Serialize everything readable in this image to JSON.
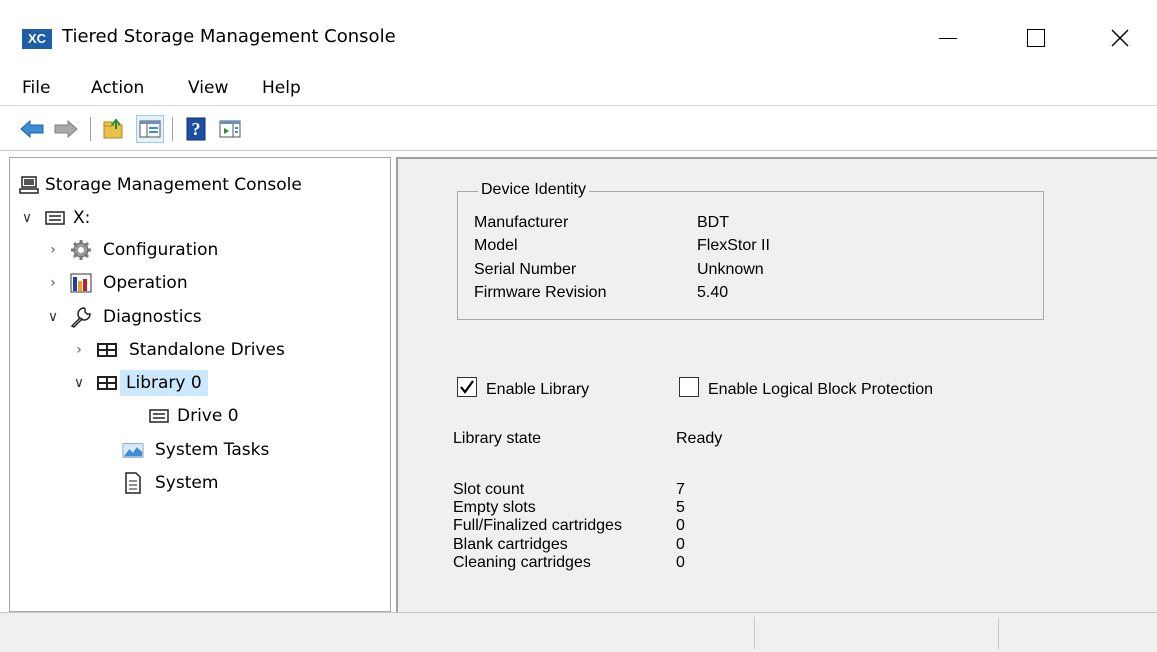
{
  "window": {
    "app_icon_text": "XC",
    "title": "Tiered Storage Management Console"
  },
  "menu": [
    "File",
    "Action",
    "View",
    "Help"
  ],
  "toolbar": [
    "back-arrow-icon",
    "forward-arrow-icon",
    "up-folder-icon",
    "show-hide-tree-icon",
    "help-icon",
    "action-pane-icon"
  ],
  "tree": {
    "root": "Storage Management Console",
    "drive_x": "X:",
    "configuration": "Configuration",
    "operation": "Operation",
    "diagnostics": "Diagnostics",
    "standalone_drives": "Standalone Drives",
    "library0": "Library 0",
    "drive0": "Drive 0",
    "system_tasks": "System Tasks",
    "system": "System"
  },
  "device_identity": {
    "title": "Device Identity",
    "rows": [
      {
        "label": "Manufacturer",
        "value": "BDT"
      },
      {
        "label": "Model",
        "value": "FlexStor II"
      },
      {
        "label": "Serial Number",
        "value": "Unknown"
      },
      {
        "label": "Firmware Revision",
        "value": "5.40"
      }
    ]
  },
  "options": {
    "enable_library": {
      "label": "Enable Library",
      "checked": true
    },
    "enable_lbp": {
      "label": "Enable Logical Block Protection",
      "checked": false
    }
  },
  "library_state": {
    "label": "Library state",
    "value": "Ready"
  },
  "counts": [
    {
      "label": "Slot count",
      "value": "7"
    },
    {
      "label": "Empty slots",
      "value": "5"
    },
    {
      "label": "Full/Finalized cartridges",
      "value": "0"
    },
    {
      "label": "Blank cartridges",
      "value": "0"
    },
    {
      "label": "Cleaning cartridges",
      "value": "0"
    }
  ],
  "colors": {
    "selection": "#cce8ff",
    "pane_bg": "#f0f0f0",
    "accent_arrow": "#3b8ed6"
  }
}
